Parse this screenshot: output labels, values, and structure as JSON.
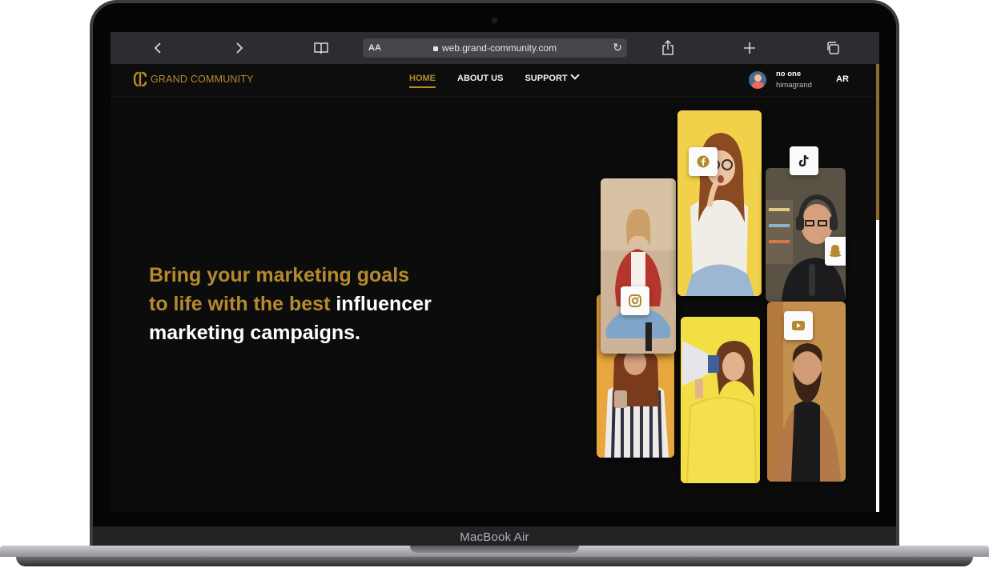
{
  "browser": {
    "reader_label": "AA",
    "url": "web.grand-community.com",
    "icons": [
      "chevron-left-icon",
      "chevron-right-icon",
      "book-icon",
      "lock-icon",
      "reload-icon",
      "share-icon",
      "plus-icon",
      "tabs-icon"
    ]
  },
  "site": {
    "logo_text": "GRAND COMMUNITY",
    "nav": {
      "home": "HOME",
      "about": "ABOUT US",
      "support": "SUPPORT"
    },
    "user": {
      "name": "no one",
      "handle": "himagrand"
    },
    "language": "AR"
  },
  "hero": {
    "line1": "Bring your marketing goals",
    "line2_gold": "to life with the best ",
    "line2_white": "influencer",
    "line3": "marketing campaigns."
  },
  "collage": {
    "badges": [
      "facebook-icon",
      "tiktok-icon",
      "instagram-icon",
      "snapchat-icon",
      "youtube-icon"
    ]
  },
  "device": {
    "brand": "MacBook Air"
  },
  "colors": {
    "accent": "#b58a2e",
    "background": "#0c0c0d",
    "toolbar": "#2c2d31"
  }
}
